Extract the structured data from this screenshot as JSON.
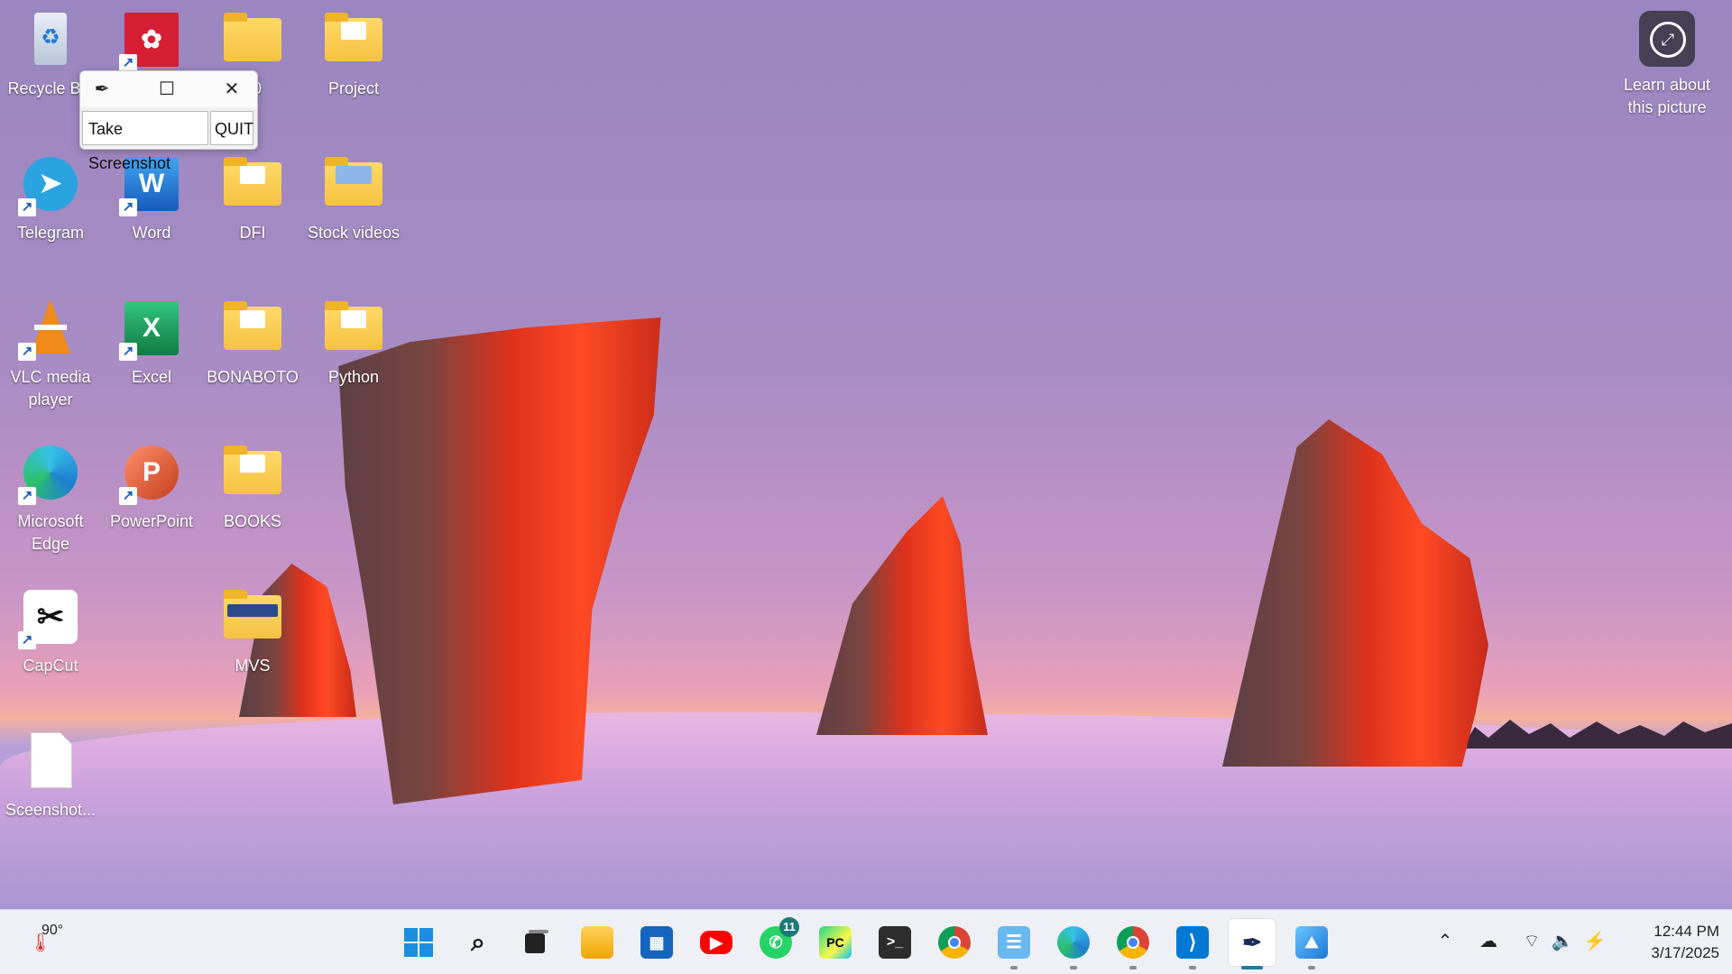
{
  "desktop_icons": {
    "recycle_bin": "Recycle Bin",
    "mendeley": "",
    "folder_hidden": "00",
    "project": "Project",
    "telegram": "Telegram",
    "word": "Word",
    "dfi": "DFI",
    "stock_videos": "Stock videos",
    "vlc": "VLC media player",
    "excel": "Excel",
    "bonaboto": "BONABOTO",
    "python": "Python",
    "edge": "Microsoft Edge",
    "powerpoint": "PowerPoint",
    "books": "BOOKS",
    "capcut": "CapCut",
    "mvs": "MVS",
    "screenshot_file": "Sceenshot..."
  },
  "tk_window": {
    "title_icon": "feather-icon",
    "take_screenshot": "Take Screenshot",
    "quit": "QUIT"
  },
  "learn_picture": {
    "line1": "Learn about",
    "line2": "this picture"
  },
  "taskbar": {
    "weather_temp": "90°",
    "whatsapp_badge": "11",
    "time": "12:44 PM",
    "date": "3/17/2025",
    "apps": [
      "start-icon",
      "search-icon",
      "task-view-icon",
      "file-explorer-icon",
      "microsoft-store-icon",
      "youtube-icon",
      "whatsapp-icon",
      "pycharm-icon",
      "terminal-icon",
      "chrome-icon",
      "notepad-icon",
      "edge-icon",
      "chrome-profile-icon",
      "vscode-icon",
      "tk-feather-icon",
      "photos-icon"
    ]
  },
  "colors": {
    "accent": "#1b7f9b",
    "taskbar_bg": "#eef0f6"
  }
}
